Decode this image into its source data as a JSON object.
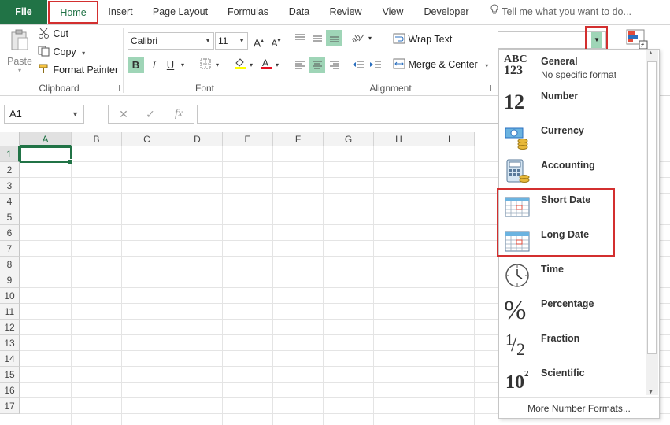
{
  "tabs": {
    "file": "File",
    "home": "Home",
    "insert": "Insert",
    "page_layout": "Page Layout",
    "formulas": "Formulas",
    "data": "Data",
    "review": "Review",
    "view": "View",
    "developer": "Developer",
    "tell_me": "Tell me what you want to do..."
  },
  "clipboard": {
    "paste": "Paste",
    "cut": "Cut",
    "copy": "Copy",
    "format_painter": "Format Painter",
    "label": "Clipboard"
  },
  "font": {
    "name": "Calibri",
    "size": "11",
    "bold": "B",
    "italic": "I",
    "underline": "U",
    "grow": "A",
    "shrink": "A",
    "color_letter": "A",
    "label": "Font",
    "highlight_color": "#ffff00",
    "font_color": "#e81123"
  },
  "alignment": {
    "wrap_text": "Wrap Text",
    "merge_center": "Merge & Center",
    "label": "Alignment"
  },
  "formula_bar": {
    "name_box": "A1",
    "cancel": "✕",
    "enter": "✓",
    "fx": "fx"
  },
  "columns": [
    "A",
    "B",
    "C",
    "D",
    "E",
    "F",
    "G",
    "H",
    "I"
  ],
  "rows": [
    "1",
    "2",
    "3",
    "4",
    "5",
    "6",
    "7",
    "8",
    "9",
    "10",
    "11",
    "12",
    "13",
    "14",
    "15",
    "16",
    "17"
  ],
  "number_format_menu": {
    "items": [
      {
        "label": "General",
        "sub": "No specific format",
        "icon": "abc-123-icon"
      },
      {
        "label": "Number",
        "sub": "",
        "icon": "number-12-icon"
      },
      {
        "label": "Currency",
        "sub": "",
        "icon": "currency-icon"
      },
      {
        "label": "Accounting",
        "sub": "",
        "icon": "accounting-icon"
      },
      {
        "label": "Short Date",
        "sub": "",
        "icon": "calendar-icon"
      },
      {
        "label": "Long Date",
        "sub": "",
        "icon": "calendar-icon"
      },
      {
        "label": "Time",
        "sub": "",
        "icon": "clock-icon"
      },
      {
        "label": "Percentage",
        "sub": "",
        "icon": "percent-icon"
      },
      {
        "label": "Fraction",
        "sub": "",
        "icon": "fraction-icon"
      },
      {
        "label": "Scientific",
        "sub": "",
        "icon": "scientific-icon"
      }
    ],
    "icon_text": {
      "general_top": "ABC",
      "general_bottom": "123",
      "number": "12",
      "percent": "%",
      "fraction_num": "1",
      "fraction_den": "2",
      "sci_base": "10",
      "sci_exp": "2"
    },
    "more": "More Number Formats..."
  },
  "colors": {
    "excel_green": "#217346",
    "highlight_red": "#d32f2f",
    "selected_green": "#9fd5b7"
  }
}
